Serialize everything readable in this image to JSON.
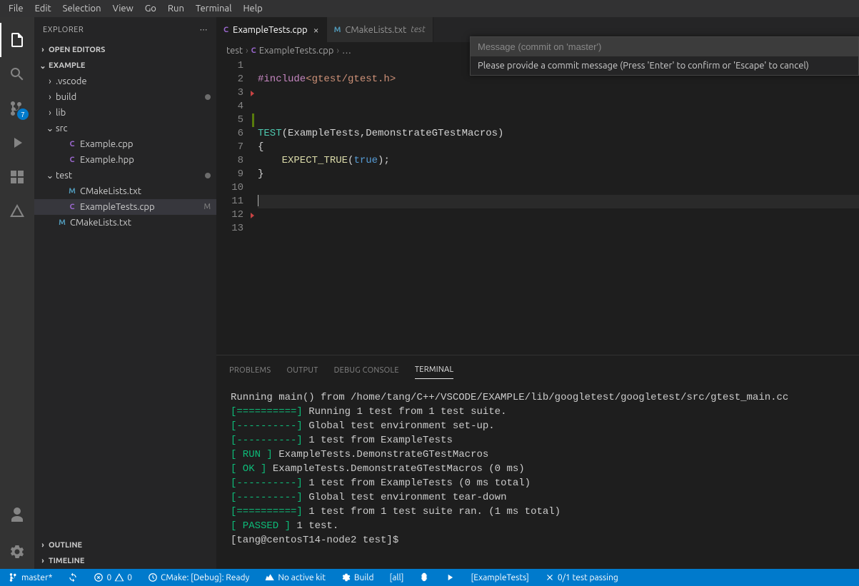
{
  "menubar": [
    "File",
    "Edit",
    "Selection",
    "View",
    "Go",
    "Run",
    "Terminal",
    "Help"
  ],
  "activity": {
    "scm_badge": "7"
  },
  "sidebar": {
    "title": "EXPLORER",
    "openEditors": "OPEN EDITORS",
    "project": "EXAMPLE",
    "tree": [
      {
        "kind": "folder",
        "label": ".vscode",
        "depth": 1,
        "expanded": false
      },
      {
        "kind": "folder",
        "label": "build",
        "depth": 1,
        "expanded": false,
        "dot": true
      },
      {
        "kind": "folder",
        "label": "lib",
        "depth": 1,
        "expanded": false
      },
      {
        "kind": "folder",
        "label": "src",
        "depth": 1,
        "expanded": true
      },
      {
        "kind": "file",
        "label": "Example.cpp",
        "depth": 2,
        "icon": "cpp"
      },
      {
        "kind": "file",
        "label": "Example.hpp",
        "depth": 2,
        "icon": "cpp"
      },
      {
        "kind": "folder",
        "label": "test",
        "depth": 1,
        "expanded": true,
        "dot": true
      },
      {
        "kind": "file",
        "label": "CMakeLists.txt",
        "depth": 2,
        "icon": "cmake"
      },
      {
        "kind": "file",
        "label": "ExampleTests.cpp",
        "depth": 2,
        "icon": "cpp",
        "selected": true,
        "dec": "M"
      },
      {
        "kind": "file",
        "label": "CMakeLists.txt",
        "depth": 1,
        "icon": "cmake"
      }
    ],
    "outline": "OUTLINE",
    "timeline": "TIMELINE"
  },
  "tabs": [
    {
      "label": "ExampleTests.cpp",
      "icon": "cpp",
      "active": true,
      "close": true
    },
    {
      "label": "CMakeLists.txt",
      "icon": "cmake",
      "desc": "test"
    }
  ],
  "breadcrumb": {
    "parts": [
      "test",
      "ExampleTests.cpp"
    ],
    "more": "…"
  },
  "code": {
    "l2": {
      "a": "#include",
      "b": "<gtest/gtest.h>"
    },
    "l6": {
      "a": "TEST",
      "b": "(ExampleTests,DemonstrateGTestMacros)"
    },
    "l7": "{",
    "l8": {
      "a": "    EXPECT_TRUE",
      "b": "(",
      "c": "true",
      "d": ");"
    },
    "l9": "}"
  },
  "panel": {
    "tabs": [
      "PROBLEMS",
      "OUTPUT",
      "DEBUG CONSOLE",
      "TERMINAL"
    ],
    "active": 3
  },
  "terminal": {
    "l1": "Running main() from /home/tang/C++/VSCODE/EXAMPLE/lib/googletest/googletest/src/gtest_main.cc",
    "l2a": "[==========]",
    "l2b": " Running 1 test from 1 test suite.",
    "l3a": "[----------]",
    "l3b": " Global test environment set-up.",
    "l4a": "[----------]",
    "l4b": " 1 test from ExampleTests",
    "l5a": "[ RUN      ]",
    "l5b": " ExampleTests.DemonstrateGTestMacros",
    "l6a": "[       OK ]",
    "l6b": " ExampleTests.DemonstrateGTestMacros (0 ms)",
    "l7a": "[----------]",
    "l7b": " 1 test from ExampleTests (0 ms total)",
    "l8": "",
    "l9a": "[----------]",
    "l9b": " Global test environment tear-down",
    "l10a": "[==========]",
    "l10b": " 1 test from 1 test suite ran. (1 ms total)",
    "l11a": "[  PASSED  ]",
    "l11b": " 1 test.",
    "l12": "[tang@centosT14-node2 test]$"
  },
  "commit": {
    "placeholder": "Message (commit on 'master')",
    "error": "Please provide a commit message (Press 'Enter' to confirm or 'Escape' to cancel)"
  },
  "status": {
    "branch": "master*",
    "errors": "0",
    "warnings": "0",
    "cmake": "CMake: [Debug]: Ready",
    "kit": "No active kit",
    "build": "Build",
    "target": "[all]",
    "launch": "[ExampleTests]",
    "tests": "0/1 test passing"
  }
}
